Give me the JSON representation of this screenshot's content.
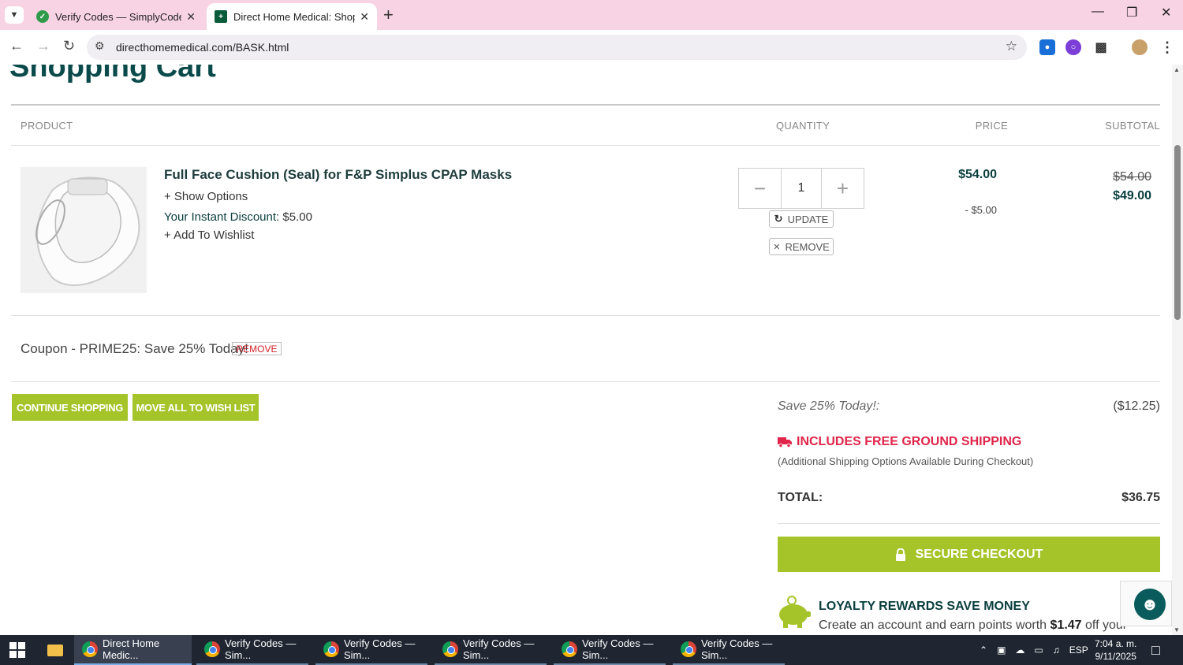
{
  "browser": {
    "tabs": [
      {
        "title": "Verify Codes — SimplyCodes",
        "active": false
      },
      {
        "title": "Direct Home Medical: Shopping",
        "active": true
      }
    ],
    "url": "directhomemedical.com/BASK.html"
  },
  "page": {
    "heading": "Shopping Cart",
    "columns": {
      "product": "PRODUCT",
      "quantity": "QUANTITY",
      "price": "PRICE",
      "subtotal": "SUBTOTAL"
    },
    "item": {
      "name": "Full Face Cushion (Seal) for F&P Simplus CPAP Masks",
      "show_options": "+ Show Options",
      "discount_label": "Your Instant Discount:",
      "discount_value": "$5.00",
      "wishlist": "+ Add To Wishlist",
      "quantity": "1",
      "update_label": "UPDATE",
      "remove_label": "REMOVE",
      "price": "$54.00",
      "price_discount": "- $5.00",
      "subtotal_old": "$54.00",
      "subtotal_new": "$49.00"
    },
    "coupon": {
      "text": "Coupon - PRIME25: Save 25% Today!",
      "remove_label": "REMOVE"
    },
    "buttons": {
      "continue": "CONTINUE SHOPPING",
      "move_all": "MOVE ALL TO WISH LIST"
    },
    "summary": {
      "save_label": "Save 25% Today!:",
      "save_value": "($12.25)",
      "shipping": "INCLUDES FREE GROUND SHIPPING",
      "shipping_note": "(Additional Shipping Options Available During Checkout)",
      "total_label": "TOTAL:",
      "total_value": "$36.75",
      "checkout": "SECURE CHECKOUT"
    },
    "loyalty": {
      "title": "LOYALTY REWARDS SAVE MONEY",
      "text_pre": "Create an account and earn points worth",
      "text_amount": "$1.47",
      "text_post": "off your"
    }
  },
  "taskbar": {
    "items": [
      {
        "label": "Direct Home Medic..."
      },
      {
        "label": "Verify Codes — Sim..."
      },
      {
        "label": "Verify Codes — Sim..."
      },
      {
        "label": "Verify Codes — Sim..."
      },
      {
        "label": "Verify Codes — Sim..."
      },
      {
        "label": "Verify Codes — Sim..."
      }
    ],
    "language": "ESP",
    "time": "7:04 a. m.",
    "date": "9/11/2025"
  },
  "colors": {
    "accent_green": "#a4c42a",
    "heading_teal": "#0a4a4a",
    "shipping_red": "#e0254a",
    "tabbar_pink": "#f8d3e4"
  }
}
